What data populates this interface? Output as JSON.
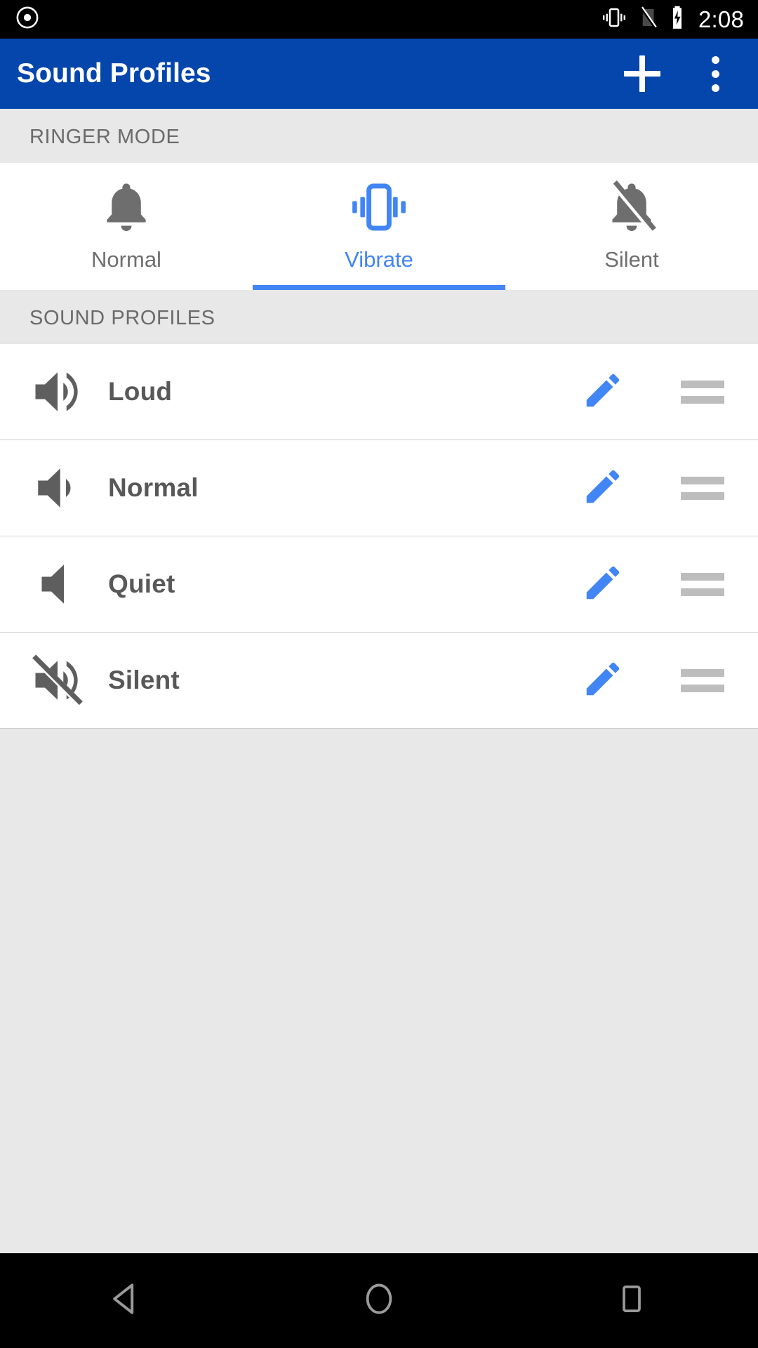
{
  "statusbar": {
    "time": "2:08",
    "icons": {
      "record": "record-dot-icon",
      "vibrate": "vibrate-icon",
      "signal_off": "signal-off-icon",
      "battery_charging": "battery-charging-icon"
    }
  },
  "appbar": {
    "title": "Sound Profiles",
    "add_label": "add-icon",
    "overflow_label": "overflow-menu-icon",
    "color": "#0546ad"
  },
  "ringer_section": {
    "header": "RINGER MODE",
    "tabs": [
      {
        "label": "Normal",
        "icon": "bell-icon",
        "active": false
      },
      {
        "label": "Vibrate",
        "icon": "vibrate-icon",
        "active": true
      },
      {
        "label": "Silent",
        "icon": "bell-off-icon",
        "active": false
      }
    ],
    "active_color": "#4285f4",
    "inactive_color": "#6e6e6e"
  },
  "profiles_section": {
    "header": "SOUND PROFILES",
    "rows": [
      {
        "label": "Loud",
        "icon": "volume-up-icon",
        "edit": "edit-pencil-icon",
        "handle": "drag-handle-icon"
      },
      {
        "label": "Normal",
        "icon": "volume-down-icon",
        "edit": "edit-pencil-icon",
        "handle": "drag-handle-icon"
      },
      {
        "label": "Quiet",
        "icon": "volume-mute-icon",
        "edit": "edit-pencil-icon",
        "handle": "drag-handle-icon"
      },
      {
        "label": "Silent",
        "icon": "volume-off-icon",
        "edit": "edit-pencil-icon",
        "handle": "drag-handle-icon"
      }
    ],
    "edit_color": "#4285f4",
    "handle_color": "#bdbdbd"
  },
  "navbar": {
    "back": "back-triangle-icon",
    "home": "home-circle-icon",
    "recents": "recents-square-icon"
  }
}
